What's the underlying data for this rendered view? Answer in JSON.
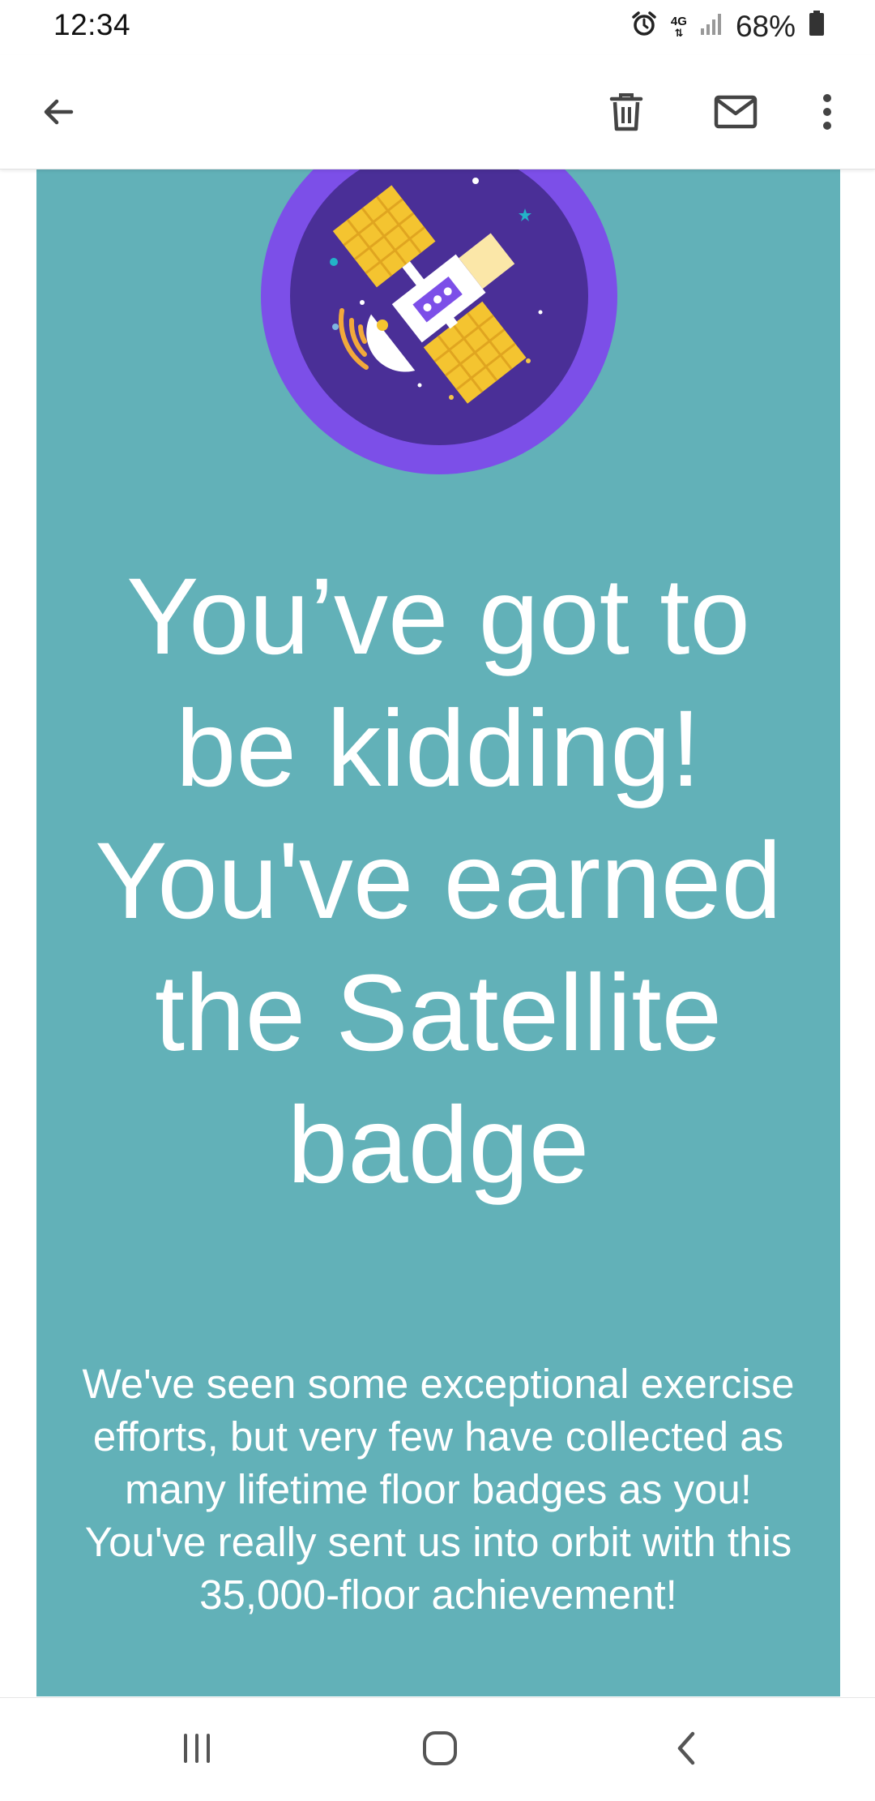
{
  "status_bar": {
    "time": "12:34",
    "network": "4G",
    "battery": "68%",
    "icons": [
      "alarm-icon",
      "network-icon",
      "signal-icon",
      "battery-icon"
    ]
  },
  "app_bar": {
    "icons": [
      "back-arrow-icon",
      "delete-icon",
      "mail-icon",
      "more-vert-icon"
    ]
  },
  "email": {
    "background_color": "#62b1b8",
    "badge_icon": "satellite-badge-icon",
    "headline": "You’ve got to be kidding! You've earned the Satellite badge",
    "body": "We've seen some exceptional exercise efforts, but very few have collected as many lifetime floor badges as you! You've really sent us into orbit with this 35,000-floor achievement!"
  },
  "nav_bar": {
    "icons": [
      "recent-apps-icon",
      "home-icon",
      "back-icon"
    ]
  }
}
